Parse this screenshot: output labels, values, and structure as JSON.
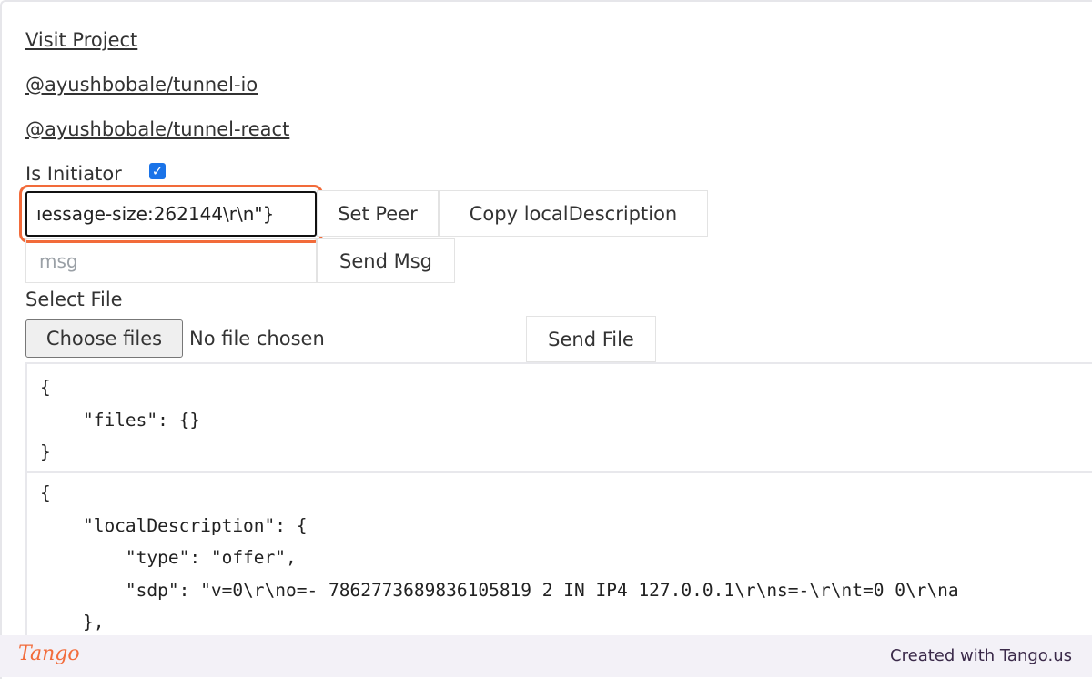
{
  "links": [
    "Visit Project",
    "@ayushbobale/tunnel-io",
    "@ayushbobale/tunnel-react"
  ],
  "initiator": {
    "label": "Is Initiator",
    "checked": true
  },
  "peer_input": {
    "value": "ıessage-size:262144\\r\\n\"}"
  },
  "buttons": {
    "set_peer": "Set Peer",
    "copy_local": "Copy localDescription",
    "send_msg": "Send Msg",
    "send_file": "Send File",
    "choose_files": "Choose files"
  },
  "msg_input": {
    "placeholder": "msg"
  },
  "select_file_label": "Select File",
  "file_status": "No file chosen",
  "files_json": "{\n    \"files\": {}\n}",
  "local_json": "{\n    \"localDescription\": {\n        \"type\": \"offer\",\n        \"sdp\": \"v=0\\r\\no=- 7862773689836105819 2 IN IP4 127.0.0.1\\r\\ns=-\\r\\nt=0 0\\r\\na\n    },",
  "footer": {
    "logo": "Tango",
    "credit": "Created with Tango.us"
  },
  "colors": {
    "highlight": "#f26b3a",
    "checkbox": "#1a73e8"
  }
}
